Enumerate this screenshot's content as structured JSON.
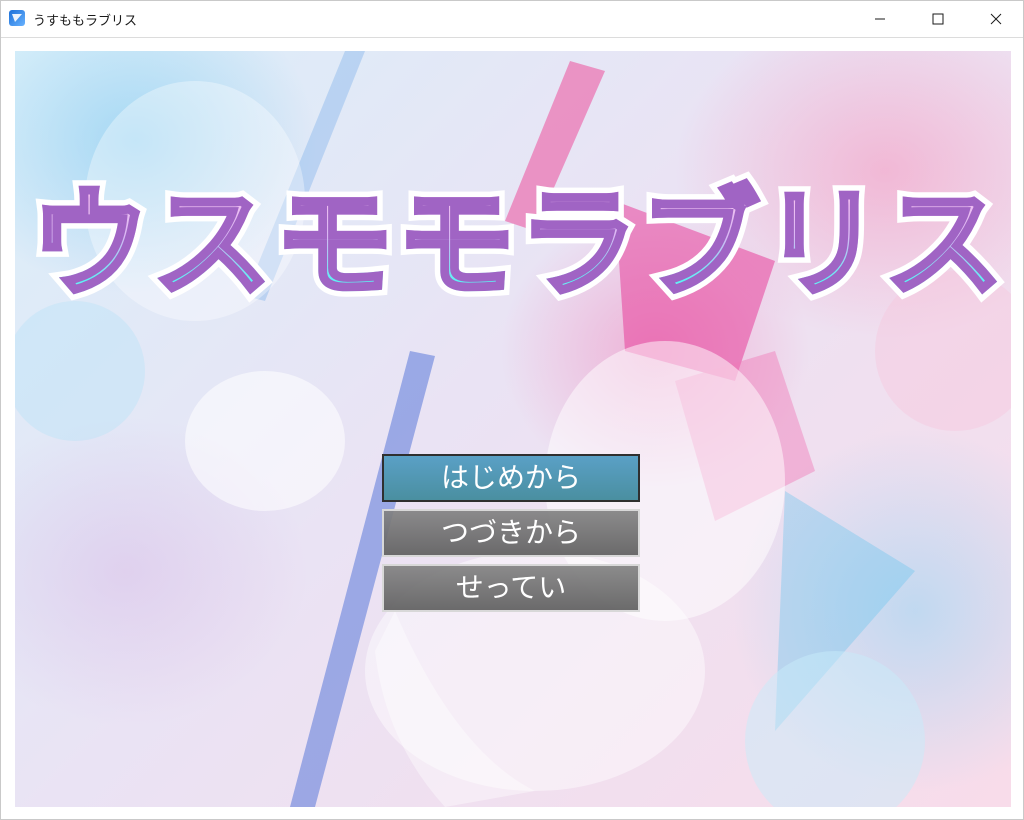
{
  "window": {
    "title": "うすももラブリス",
    "icon": "app-icon",
    "controls": [
      "minimize-icon",
      "maximize-icon",
      "close-icon"
    ]
  },
  "logo": {
    "text": "ウスモモラブリス",
    "colors": {
      "outline": "#a064c4",
      "fill_top": "#f7c2f0",
      "fill_bottom": "#5cf2f4"
    }
  },
  "menu": {
    "items": [
      {
        "label": "はじめから",
        "selected": true
      },
      {
        "label": "つづきから",
        "selected": false
      },
      {
        "label": "せってい",
        "selected": false
      }
    ],
    "colors": {
      "selected": "#4a8fa0",
      "normal": "#6e6e6e"
    }
  }
}
